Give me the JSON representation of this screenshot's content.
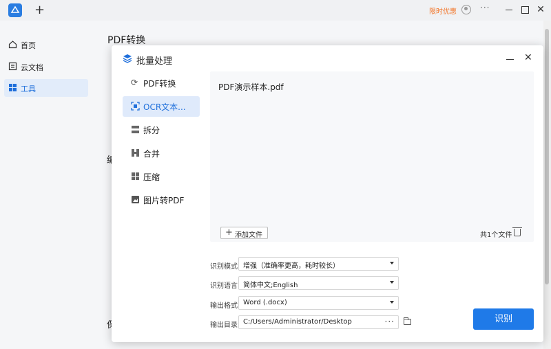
{
  "titlebar": {
    "new_tab": "+",
    "promo": "限时优惠",
    "more": "···",
    "close": "✕"
  },
  "sidebar": {
    "items": [
      {
        "label": "首页",
        "icon": "home-icon"
      },
      {
        "label": "云文档",
        "icon": "cloud-doc-icon"
      },
      {
        "label": "工具",
        "icon": "tools-icon",
        "active": true
      }
    ]
  },
  "background_page": {
    "title": "PDF转换",
    "fragment_1": "编",
    "fragment_2": "保"
  },
  "modal": {
    "title": "批量处理",
    "close": "✕",
    "nav": [
      {
        "label": "PDF转换",
        "icon": "refresh-icon"
      },
      {
        "label": "OCR文本...",
        "icon": "ocr-scan-icon",
        "active": true
      },
      {
        "label": "拆分",
        "icon": "split-icon"
      },
      {
        "label": "合并",
        "icon": "merge-icon"
      },
      {
        "label": "压缩",
        "icon": "compress-icon"
      },
      {
        "label": "图片转PDF",
        "icon": "image-to-pdf-icon"
      }
    ],
    "files": [
      "PDF演示样本.pdf"
    ],
    "add_file": "添加文件",
    "file_count": "共1个文件",
    "form": {
      "mode_label": "识别模式",
      "mode_value": "增强（准确率更高，耗时较长）",
      "lang_label": "识别语言",
      "lang_value": "简体中文;English",
      "format_label": "输出格式",
      "format_value": "Word (.docx)",
      "dir_label": "输出目录",
      "dir_value": "C:/Users/Administrator/Desktop",
      "dir_more": "···"
    },
    "run_button": "识别"
  },
  "colors": {
    "accent": "#1f7ae8",
    "promo": "#f2762a",
    "active_bg": "#e2ecfa"
  }
}
